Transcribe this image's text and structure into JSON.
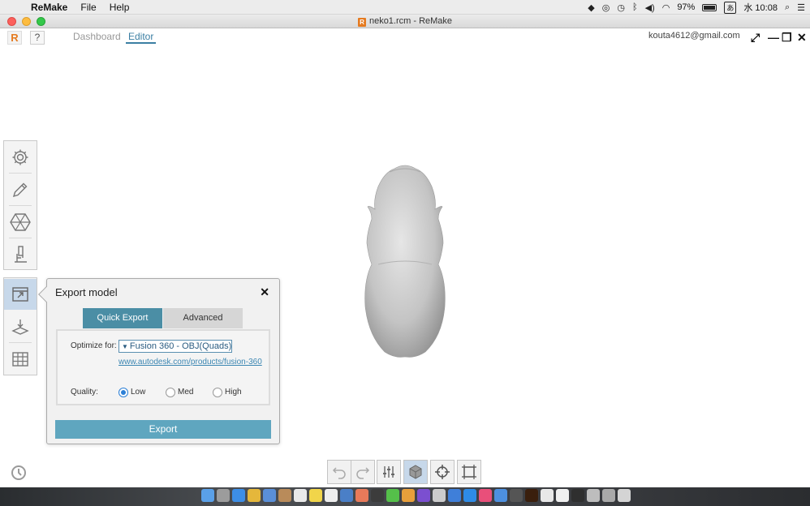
{
  "menubar": {
    "app_name": "ReMake",
    "items": [
      "File",
      "Help"
    ],
    "battery": "97%",
    "ime": "あ",
    "clock": "水 10:08"
  },
  "window": {
    "title": "neko1.rcm - ReMake"
  },
  "appbar": {
    "help_label": "?",
    "tabs": [
      {
        "label": "Dashboard",
        "active": false
      },
      {
        "label": "Editor",
        "active": true
      }
    ],
    "user_email": "kouta4612@gmail.com"
  },
  "left_tools": {
    "top": [
      "gear-icon",
      "pencil-icon",
      "mesh-icon",
      "microscope-icon"
    ],
    "bottom": [
      "export-icon",
      "print-icon",
      "grid-icon"
    ]
  },
  "export_dialog": {
    "title": "Export model",
    "tabs": [
      {
        "label": "Quick Export",
        "active": true
      },
      {
        "label": "Advanced",
        "active": false
      }
    ],
    "optimize_label": "Optimize for:",
    "optimize_value": "Fusion 360 - OBJ(Quads)",
    "link": "www.autodesk.com/products/fusion-360",
    "quality_label": "Quality:",
    "quality_options": [
      {
        "label": "Low",
        "checked": true
      },
      {
        "label": "Med",
        "checked": false
      },
      {
        "label": "High",
        "checked": false
      }
    ],
    "export_button": "Export"
  },
  "bottom_toolbar": [
    "undo-icon",
    "redo-icon",
    "sliders-icon",
    "cube-icon",
    "crosshair-icon",
    "frame-icon"
  ],
  "colors": {
    "accent": "#4b8ea5",
    "export_button": "#5fa6bf",
    "selected_tool": "#c7d8ea",
    "link": "#3b86b2"
  }
}
